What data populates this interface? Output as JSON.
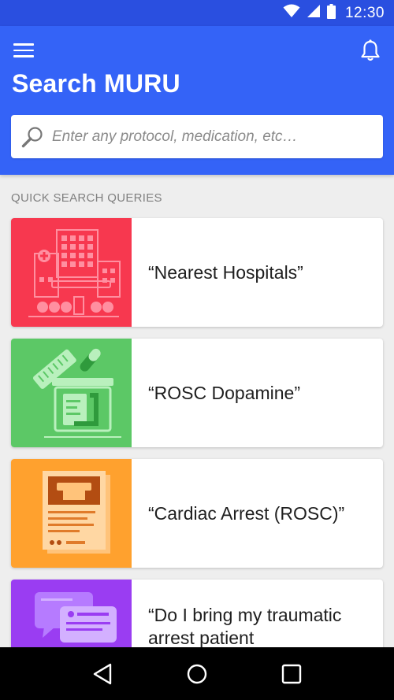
{
  "status_bar": {
    "time": "12:30",
    "icons": [
      "wifi-icon",
      "cell-signal-icon",
      "battery-icon"
    ]
  },
  "header": {
    "title": "Search MURU",
    "menu_icon": "menu-icon",
    "notification_icon": "bell-icon",
    "search": {
      "placeholder": "Enter any protocol, medication, etc…",
      "value": "",
      "icon": "search-icon"
    }
  },
  "quick_search": {
    "label": "QUICK SEARCH QUERIES",
    "items": [
      {
        "text": "“Nearest Hospitals”",
        "color": "#f7384f",
        "illustration": "hospital-illustration"
      },
      {
        "text": "“ROSC Dopamine”",
        "color": "#5cc866",
        "illustration": "medication-illustration"
      },
      {
        "text": "“Cardiac Arrest (ROSC)”",
        "color": "#ffa12e",
        "illustration": "protocol-document-illustration"
      },
      {
        "text": "“Do I bring my traumatic arrest patient",
        "color": "#9a3df2",
        "illustration": "chat-illustration"
      }
    ]
  },
  "colors": {
    "status_bar": "#2a4fe0",
    "header": "#3463f7",
    "background": "#eeeeee"
  },
  "nav_bar": {
    "icons": [
      "back-icon",
      "home-icon",
      "recents-icon"
    ]
  }
}
